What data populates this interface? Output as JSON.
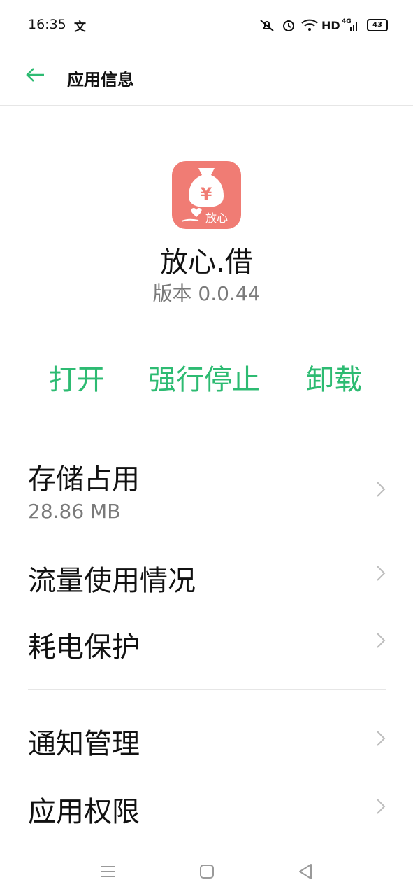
{
  "status_bar": {
    "time": "16:35",
    "input_glyph": "文",
    "icons": [
      "muted-notification-icon",
      "alarm-icon",
      "wifi-icon"
    ],
    "hd": "HD",
    "network": "4G",
    "battery": "43"
  },
  "header": {
    "title": "应用信息",
    "back_icon": "arrow-left-icon"
  },
  "app": {
    "name": "放心.借",
    "version": "版本 0.0.44",
    "icon_text": "放心",
    "icon_symbol": "¥",
    "icon_bg": "#f07c74"
  },
  "actions": {
    "open": "打开",
    "force_stop": "强行停止",
    "uninstall": "卸载",
    "color": "#2dbb72"
  },
  "settings": {
    "storage": {
      "label": "存储占用",
      "value": "28.86 MB"
    },
    "data_usage": {
      "label": "流量使用情况"
    },
    "battery_protection": {
      "label": "耗电保护"
    },
    "notifications": {
      "label": "通知管理"
    },
    "permissions": {
      "label": "应用权限"
    }
  },
  "nav": {
    "icons": [
      "menu-icon",
      "home-icon",
      "back-triangle-icon"
    ]
  }
}
